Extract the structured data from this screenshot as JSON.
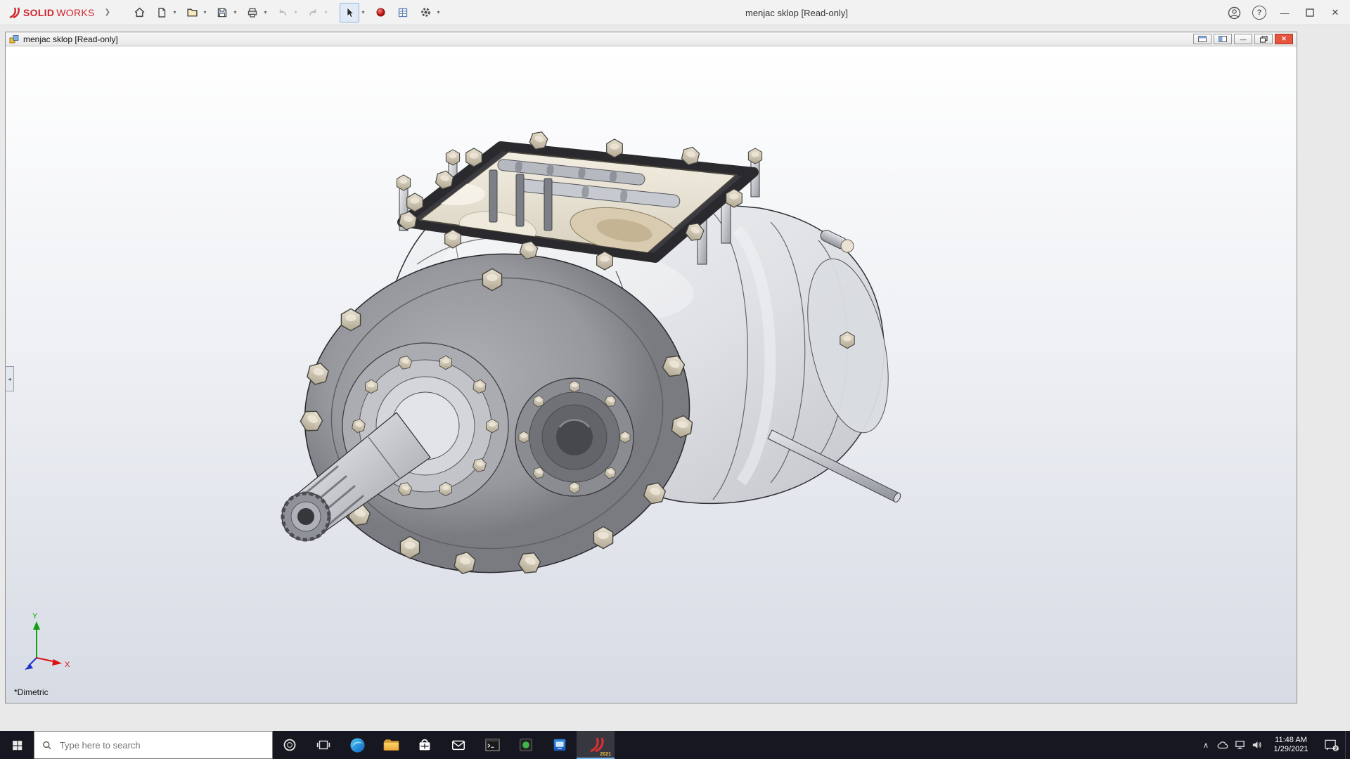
{
  "app_titlebar": {
    "brand_solid": "SOLID",
    "brand_works": "WORKS",
    "title": "menjac sklop [Read-only]",
    "breadcrumb_glyph": "❯",
    "dropdown_glyph": "▾",
    "help_glyph": "?",
    "minimize_glyph": "—",
    "close_glyph": "✕",
    "toolbar_icons": [
      "home",
      "new-document",
      "open",
      "save",
      "print",
      "undo",
      "redo",
      "select-cursor",
      "appearance-sphere",
      "design-table",
      "options-gear"
    ]
  },
  "document_window": {
    "title": "menjac sklop [Read-only]",
    "view_label": "*Dimetric",
    "triad_x": "X",
    "triad_y": "Y",
    "collapse_glyph": "◂",
    "minimize_glyph": "—",
    "close_glyph": "✕"
  },
  "taskbar": {
    "search_placeholder": "Type here to search",
    "solidworks_year": "2021",
    "tray_chevron": "∧",
    "clock_time": "11:48 AM",
    "clock_date": "1/29/2021",
    "notification_badge": "2",
    "pinned_apps": [
      "start",
      "search",
      "cortana",
      "task-view",
      "edge",
      "file-explorer",
      "store",
      "mail",
      "terminal",
      "notes-app",
      "media-app",
      "solidworks-2021"
    ],
    "tray_icons": [
      "hidden-icons-chevron",
      "onedrive",
      "network",
      "volume",
      "action-center"
    ]
  },
  "colors": {
    "brand_red": "#d2232a",
    "taskbar_bg": "#171721",
    "viewport_gradient_top": "#ffffff",
    "viewport_gradient_bottom": "#d7dbe4",
    "triad_x_color": "#dd1111",
    "triad_y_color": "#11a011",
    "triad_z_color": "#2233cc"
  }
}
